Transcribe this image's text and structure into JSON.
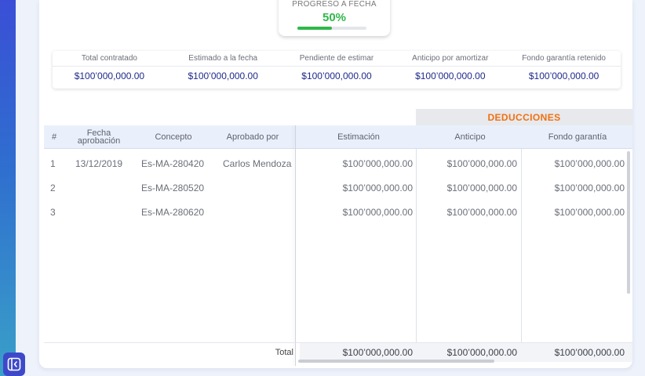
{
  "progress": {
    "label": "PROGRESO A FECHA",
    "value": "50%",
    "fraction": 0.5
  },
  "summary": [
    {
      "label": "Total contratado",
      "value": "$100’000,000.00"
    },
    {
      "label": "Estimado a la fecha",
      "value": "$100’000,000.00"
    },
    {
      "label": "Pendiente de estimar",
      "value": "$100’000,000.00"
    },
    {
      "label": "Anticipo por amortizar",
      "value": "$100’000,000.00"
    },
    {
      "label": "Fondo garantía retenido",
      "value": "$100’000,000.00"
    }
  ],
  "table": {
    "deductions_label": "DEDUCCIONES",
    "headers": {
      "num": "#",
      "fecha": "Fecha aprobación",
      "concepto": "Concepto",
      "aprobado": "Aprobado por",
      "estimacion": "Estimación",
      "anticipo": "Anticipo",
      "fondo": "Fondo garantía"
    },
    "rows": [
      {
        "num": "1",
        "fecha": "13/12/2019",
        "concepto": "Es-MA-280420",
        "aprobado": "Carlos Mendoza",
        "estimacion": "$100’000,000.00",
        "anticipo": "$100’000,000.00",
        "fondo": "$100’000,000.00"
      },
      {
        "num": "2",
        "fecha": "",
        "concepto": "Es-MA-280520",
        "aprobado": "",
        "estimacion": "$100’000,000.00",
        "anticipo": "$100’000,000.00",
        "fondo": "$100’000,000.00"
      },
      {
        "num": "3",
        "fecha": "",
        "concepto": "Es-MA-280620",
        "aprobado": "",
        "estimacion": "$100’000,000.00",
        "anticipo": "$100’000,000.00",
        "fondo": "$100’000,000.00"
      }
    ],
    "footer": {
      "label": "Total",
      "estimacion": "$100’000,000.00",
      "anticipo": "$100’000,000.00",
      "fondo": "$100’000,000.00"
    }
  },
  "icons": {
    "collapse": "collapse-sidebar-icon"
  },
  "colors": {
    "accent_green": "#2fb84a",
    "money_blue": "#1f2a8a",
    "deductions_orange": "#f07010",
    "sidebar_blue": "#3d49c9"
  }
}
